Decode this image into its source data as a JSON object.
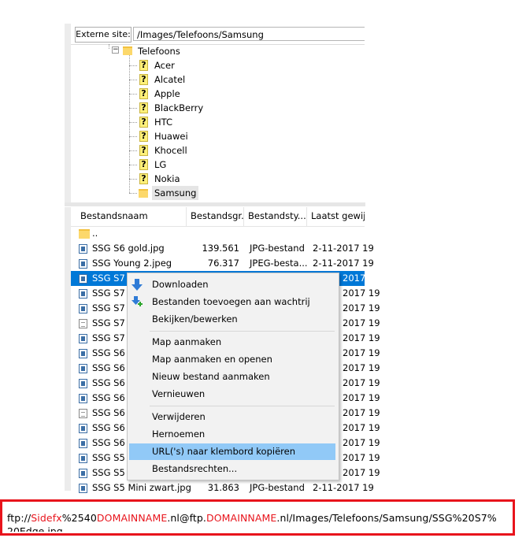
{
  "remote_site": {
    "label": "Externe site:",
    "path": "/Images/Telefoons/Samsung"
  },
  "tree": {
    "parent": "Telefoons",
    "children": [
      "Acer",
      "Alcatel",
      "Apple",
      "BlackBerry",
      "HTC",
      "Huawei",
      "Khocell",
      "LG",
      "Nokia",
      "Samsung"
    ],
    "selected": "Samsung"
  },
  "file_list": {
    "columns": [
      "Bestandsnaam",
      "Bestandsgr...",
      "Bestandsty...",
      "Laatst gewijz"
    ],
    "rows": [
      {
        "name": "..",
        "size": "",
        "type": "",
        "date": ""
      },
      {
        "name": "SSG S6 gold.jpg",
        "size": "139.561",
        "type": "JPG-bestand",
        "date": "2-11-2017 19"
      },
      {
        "name": "SSG Young 2.jpeg",
        "size": "76.317",
        "type": "JPEG-besta...",
        "date": "2-11-2017 19"
      },
      {
        "name": "SSG S7",
        "size": "",
        "type": "",
        "date": "2017 19"
      },
      {
        "name": "SSG S7",
        "size": "",
        "type": "",
        "date": "2017 19"
      },
      {
        "name": "SSG S7",
        "size": "",
        "type": "",
        "date": "2017 19"
      },
      {
        "name": "SSG S7",
        "size": "",
        "type": "",
        "date": "2017 19"
      },
      {
        "name": "SSG S7",
        "size": "",
        "type": "",
        "date": "2017 19"
      },
      {
        "name": "SSG S6",
        "size": "",
        "type": "",
        "date": "2017 19"
      },
      {
        "name": "SSG S6",
        "size": "",
        "type": "",
        "date": "2017 19"
      },
      {
        "name": "SSG S6",
        "size": "",
        "type": "",
        "date": "2017 19"
      },
      {
        "name": "SSG S6",
        "size": "",
        "type": "",
        "date": "2017 19"
      },
      {
        "name": "SSG S6",
        "size": "",
        "type": "",
        "date": "2017 19"
      },
      {
        "name": "SSG S6",
        "size": "",
        "type": "",
        "date": "2017 19"
      },
      {
        "name": "SSG S6",
        "size": "",
        "type": "",
        "date": "2017 19"
      },
      {
        "name": "SSG S5",
        "size": "",
        "type": "",
        "date": "2017 19"
      },
      {
        "name": "SSG S5",
        "size": "",
        "type": "",
        "date": "2017 19"
      },
      {
        "name": "SSG S5 Mini zwart.jpg",
        "size": "31.863",
        "type": "JPG-bestand",
        "date": "2-11-2017 19"
      }
    ],
    "selected_row": 3
  },
  "context_menu": {
    "items": [
      {
        "label": "Downloaden",
        "icon": "download-icon"
      },
      {
        "label": "Bestanden toevoegen aan wachtrij",
        "icon": "add-to-queue-icon"
      },
      {
        "label": "Bekijken/bewerken",
        "icon": ""
      },
      {
        "label": "Map aanmaken",
        "icon": ""
      },
      {
        "label": "Map aanmaken en openen",
        "icon": ""
      },
      {
        "label": "Nieuw bestand aanmaken",
        "icon": ""
      },
      {
        "label": "Vernieuwen",
        "icon": ""
      },
      {
        "label": "Verwijderen",
        "icon": ""
      },
      {
        "label": "Hernoemen",
        "icon": ""
      },
      {
        "label": "URL('s) naar klembord kopiëren",
        "icon": ""
      },
      {
        "label": "Bestandsrechten...",
        "icon": ""
      }
    ],
    "highlighted": "URL('s) naar klembord kopiëren"
  },
  "url_bar": {
    "p1": "ftp://",
    "p2": "Sidefx",
    "p3": "%2540",
    "p4": "DOMAINNAME",
    "p5": ".nl@ftp.",
    "p6": "DOMAINNAME",
    "p7": ".nl/Images/Telefoons/Samsung/SSG%20S7%",
    "line2": "20Edge.jpg"
  },
  "colors": {
    "selection": "#0078d7",
    "menu_highlight": "#91c9f7",
    "highlight_border": "#e8141c"
  }
}
